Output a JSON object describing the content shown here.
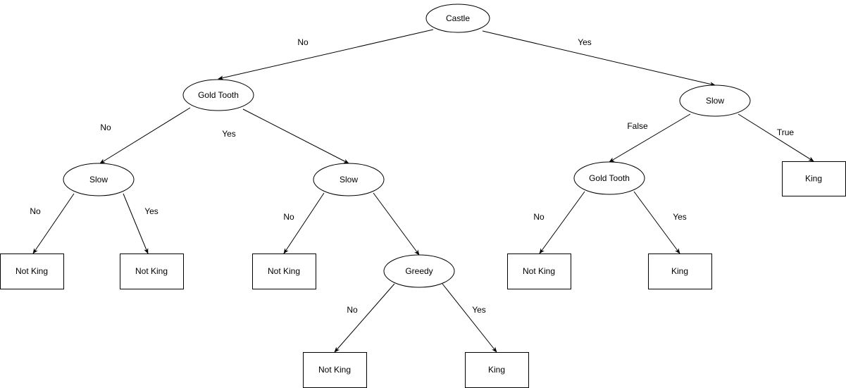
{
  "diagram": {
    "nodes": [
      {
        "id": "castle",
        "label": "Castle",
        "shape": "ellipse"
      },
      {
        "id": "gold-tooth-left",
        "label": "Gold Tooth",
        "shape": "ellipse"
      },
      {
        "id": "slow-right",
        "label": "Slow",
        "shape": "ellipse"
      },
      {
        "id": "slow-left",
        "label": "Slow",
        "shape": "ellipse"
      },
      {
        "id": "slow-middle",
        "label": "Slow",
        "shape": "ellipse"
      },
      {
        "id": "gold-tooth-right",
        "label": "Gold Tooth",
        "shape": "ellipse"
      },
      {
        "id": "king-top-right",
        "label": "King",
        "shape": "rectangle"
      },
      {
        "id": "not-king-1",
        "label": "Not King",
        "shape": "rectangle"
      },
      {
        "id": "not-king-2",
        "label": "Not King",
        "shape": "rectangle"
      },
      {
        "id": "not-king-3",
        "label": "Not King",
        "shape": "rectangle"
      },
      {
        "id": "greedy",
        "label": "Greedy",
        "shape": "ellipse"
      },
      {
        "id": "not-king-4",
        "label": "Not King",
        "shape": "rectangle"
      },
      {
        "id": "king-right",
        "label": "King",
        "shape": "rectangle"
      },
      {
        "id": "not-king-5",
        "label": "Not King",
        "shape": "rectangle"
      },
      {
        "id": "king-bottom",
        "label": "King",
        "shape": "rectangle"
      }
    ],
    "edges": [
      {
        "from": "castle",
        "to": "gold-tooth-left",
        "label": "No"
      },
      {
        "from": "castle",
        "to": "slow-right",
        "label": "Yes"
      },
      {
        "from": "gold-tooth-left",
        "to": "slow-left",
        "label": "No"
      },
      {
        "from": "gold-tooth-left",
        "to": "slow-middle",
        "label": "Yes"
      },
      {
        "from": "slow-right",
        "to": "gold-tooth-right",
        "label": "False"
      },
      {
        "from": "slow-right",
        "to": "king-top-right",
        "label": "True"
      },
      {
        "from": "slow-left",
        "to": "not-king-1",
        "label": "No"
      },
      {
        "from": "slow-left",
        "to": "not-king-2",
        "label": "Yes"
      },
      {
        "from": "slow-middle",
        "to": "not-king-3",
        "label": "No"
      },
      {
        "from": "slow-middle",
        "to": "greedy",
        "label": ""
      },
      {
        "from": "gold-tooth-right",
        "to": "not-king-4",
        "label": "No"
      },
      {
        "from": "gold-tooth-right",
        "to": "king-right",
        "label": "Yes"
      },
      {
        "from": "greedy",
        "to": "not-king-5",
        "label": "No"
      },
      {
        "from": "greedy",
        "to": "king-bottom",
        "label": "Yes"
      }
    ]
  }
}
